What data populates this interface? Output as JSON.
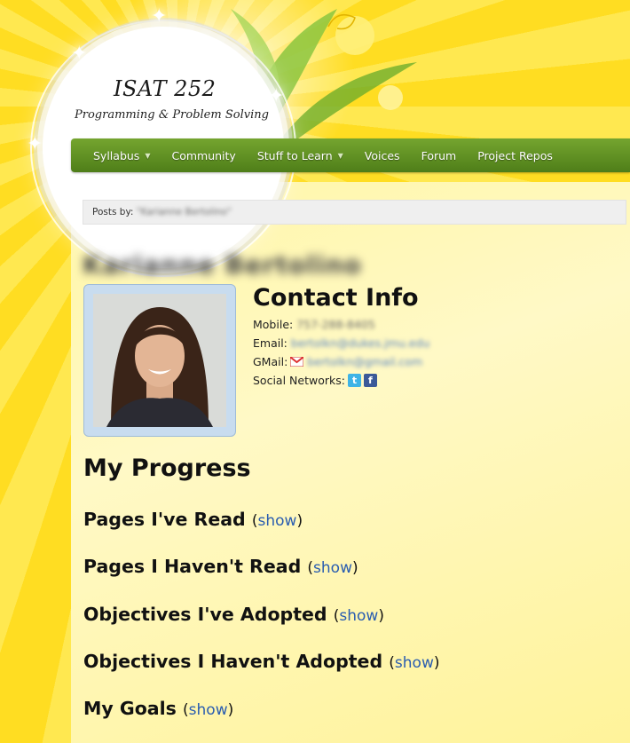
{
  "site": {
    "title": "ISAT 252",
    "subtitle": "Programming & Problem Solving"
  },
  "nav": {
    "items": [
      {
        "label": "Syllabus",
        "dropdown": true
      },
      {
        "label": "Community",
        "dropdown": false
      },
      {
        "label": "Stuff to Learn",
        "dropdown": true
      },
      {
        "label": "Voices",
        "dropdown": false
      },
      {
        "label": "Forum",
        "dropdown": false
      },
      {
        "label": "Project Repos",
        "dropdown": false
      }
    ]
  },
  "breadcrumb": {
    "prefix": "Posts by:",
    "value": "\"Karianne Bertolino\""
  },
  "profile": {
    "name": "Karianne Bertolino"
  },
  "contact": {
    "title": "Contact Info",
    "mobile_label": "Mobile:",
    "mobile_value": "757-288-8405",
    "email_label": "Email:",
    "email_value": "bertolkn@dukes.jmu.edu",
    "gmail_label": "GMail:",
    "gmail_value": "bertolkn@gmail.com",
    "social_label": "Social Networks:"
  },
  "progress": {
    "title": "My Progress",
    "show_label": "show",
    "sections": [
      {
        "label": "Pages I've Read"
      },
      {
        "label": "Pages I Haven't Read"
      },
      {
        "label": "Objectives I've Adopted"
      },
      {
        "label": "Objectives I Haven't Adopted"
      },
      {
        "label": "My Goals"
      }
    ]
  },
  "colors": {
    "nav_green": "#5a8a20",
    "link_blue": "#2a5db0",
    "background_yellow": "#ffe033"
  }
}
